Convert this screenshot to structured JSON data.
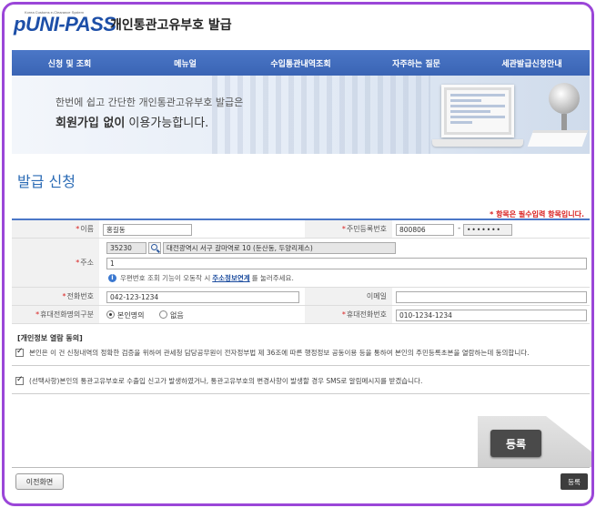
{
  "header": {
    "logo_small": "Korea Customs e-Clearance System",
    "logo_text": "UNI-PASS",
    "logo_prefix": "p",
    "site_title": "개인통관고유부호 발급"
  },
  "nav": {
    "items": [
      "신청 및 조회",
      "메뉴얼",
      "수입통관내역조회",
      "자주하는 질문",
      "세관발급신청안내"
    ]
  },
  "banner": {
    "line1_prefix": "한번에 쉽고 간단한 개인통관고유부호 발급은",
    "line2_bold": "회원가입 없이",
    "line2_rest": " 이용가능합니다."
  },
  "page": {
    "title": "발급 신청",
    "required_note": "* 항목은 필수입력 항목입니다."
  },
  "form": {
    "name_label": "이름",
    "name_value": "홍길동",
    "rrn_label": "주민등록번호",
    "rrn_front": "800806",
    "rrn_back": "•••••••",
    "address_label": "주소",
    "zip_value": "35230",
    "address_main": "대전광역시 서구 갈마역로 10 (둔산동, 두양리제스)",
    "address_detail": "1",
    "address_info_pre": "우편번호 조회 기능이 오동작 시",
    "address_info_link": "주소정보연계",
    "address_info_post": "를 눌러주세요.",
    "phone_label": "전화번호",
    "phone_value": "042-123-1234",
    "email_label": "이메일",
    "email_value": "",
    "mobile_type_label": "휴대전화명의구분",
    "mobile_type_options": [
      "본인명의",
      "없음"
    ],
    "mobile_label": "휴대전화번호",
    "mobile_value": "010-1234-1234",
    "required_mark": "*"
  },
  "consent": {
    "title": "[개인정보 열람 동의]",
    "item1": "본인은 이 건 신청내역의 정확한 검증을 위하여 관세청 담당공무원이 전자정부법 제 36조에 따른 행정정보 공동이용 등을 통하여 본인의 주민등록초본을 열람하는데 동의합니다.",
    "item2": "(선택사항)본인의 통관고유부호로 수출입 신고가 발생하였거나, 통관고유부호의 변경사항이 발생할 경우 SMS로 알림메시지를 받겠습니다."
  },
  "actions": {
    "prev_label": "이전화면",
    "submit_label": "등록",
    "zoom_label": "등록"
  }
}
